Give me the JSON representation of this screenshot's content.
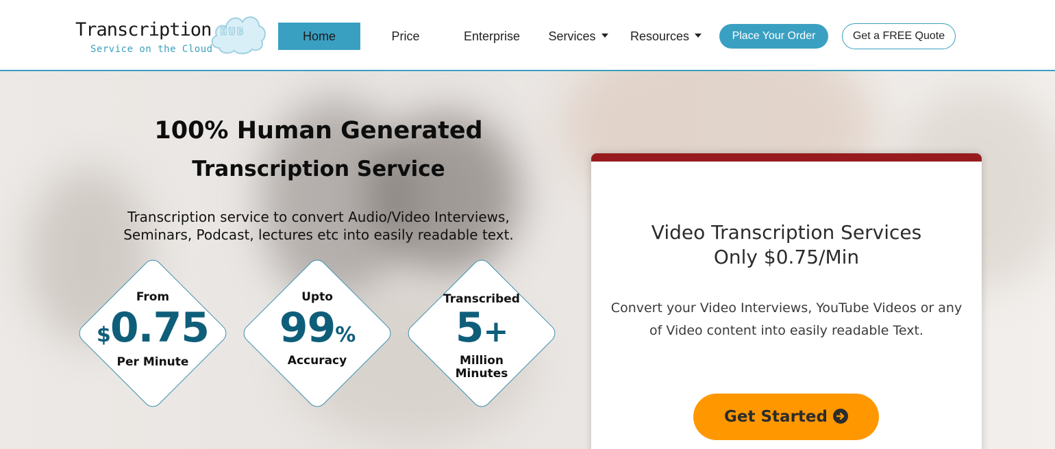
{
  "logo": {
    "word": "Transcription",
    "hub": "HUB",
    "tagline": "Service on the Cloud"
  },
  "nav": {
    "home": "Home",
    "price": "Price",
    "enterprise": "Enterprise",
    "services": "Services",
    "resources": "Resources",
    "place_order": "Place Your Order",
    "free_quote": "Get a FREE Quote"
  },
  "hero": {
    "title_line1": "100% Human Generated",
    "title_line2": "Transcription Service",
    "subtitle_line1": "Transcription service to convert Audio/Video Interviews,",
    "subtitle_line2": "Seminars, Podcast, lectures etc into easily readable text."
  },
  "badges": [
    {
      "top": "From",
      "prefix": "$",
      "value": "0.75",
      "suffix": "",
      "bottom1": "Per Minute",
      "bottom2": ""
    },
    {
      "top": "Upto",
      "prefix": "",
      "value": "99",
      "suffix": "%",
      "bottom1": "Accuracy",
      "bottom2": ""
    },
    {
      "top": "Transcribed",
      "prefix": "",
      "value": "5",
      "suffix": "+",
      "bottom1": "Million",
      "bottom2": "Minutes"
    }
  ],
  "card": {
    "title_line1": "Video Transcription Services",
    "title_line2": "Only $0.75/Min",
    "desc_line1": "Convert your Video Interviews, YouTube Videos or any",
    "desc_line2": "of Video content into easily readable Text.",
    "cta": "Get Started"
  },
  "icons": {
    "dropdown": "chevron-down-icon",
    "cta": "arrow-circle-right-icon"
  },
  "colors": {
    "accent": "#3aa0c2",
    "card_top": "#971b1e",
    "cta": "#ff9800",
    "badge_number": "#0e5e7a"
  }
}
